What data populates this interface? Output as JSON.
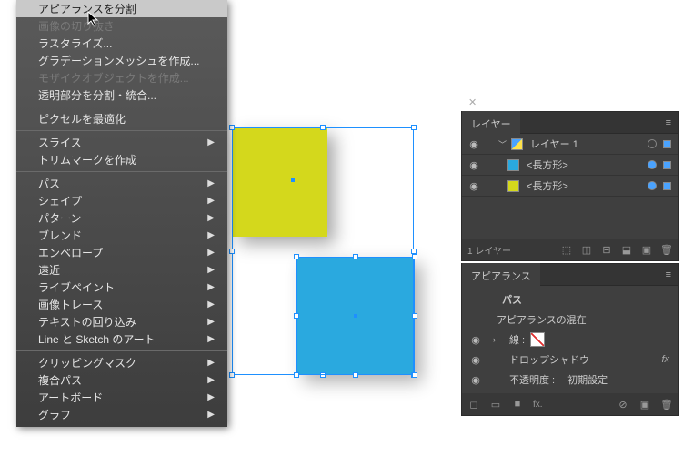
{
  "context_menu": {
    "items": [
      {
        "label": "アピアランスを分割",
        "state": "highlight"
      },
      {
        "label": "画像の切り抜き",
        "state": "disabled"
      },
      {
        "label": "ラスタライズ...",
        "state": ""
      },
      {
        "label": "グラデーションメッシュを作成...",
        "state": ""
      },
      {
        "label": "モザイクオブジェクトを作成...",
        "state": "disabled"
      },
      {
        "label": "透明部分を分割・統合...",
        "state": ""
      }
    ],
    "group2": [
      {
        "label": "ピクセルを最適化",
        "state": ""
      }
    ],
    "group3": [
      {
        "label": "スライス",
        "submenu": true
      },
      {
        "label": "トリムマークを作成",
        "submenu": false
      }
    ],
    "group4": [
      {
        "label": "パス",
        "submenu": true
      },
      {
        "label": "シェイプ",
        "submenu": true
      },
      {
        "label": "パターン",
        "submenu": true
      },
      {
        "label": "ブレンド",
        "submenu": true
      },
      {
        "label": "エンベロープ",
        "submenu": true
      },
      {
        "label": "遠近",
        "submenu": true
      },
      {
        "label": "ライブペイント",
        "submenu": true
      },
      {
        "label": "画像トレース",
        "submenu": true
      },
      {
        "label": "テキストの回り込み",
        "submenu": true
      },
      {
        "label": "Line と Sketch のアート",
        "submenu": true
      }
    ],
    "group5": [
      {
        "label": "クリッピングマスク",
        "submenu": true
      },
      {
        "label": "複合パス",
        "submenu": true
      },
      {
        "label": "アートボード",
        "submenu": true
      },
      {
        "label": "グラフ",
        "submenu": true
      }
    ]
  },
  "layers_panel": {
    "title": "レイヤー",
    "layer_name": "レイヤー 1",
    "item_blue": "<長方形>",
    "item_yellow": "<長方形>",
    "footer_count": "1 レイヤー"
  },
  "appearance_panel": {
    "title": "アピアランス",
    "path_label": "パス",
    "mix_label": "アピアランスの混在",
    "stroke_label": "線 :",
    "shadow_label": "ドロップシャドウ",
    "opacity_label": "不透明度 :",
    "opacity_value": "初期設定",
    "fx_label": "fx",
    "footer_fx": "fx."
  }
}
